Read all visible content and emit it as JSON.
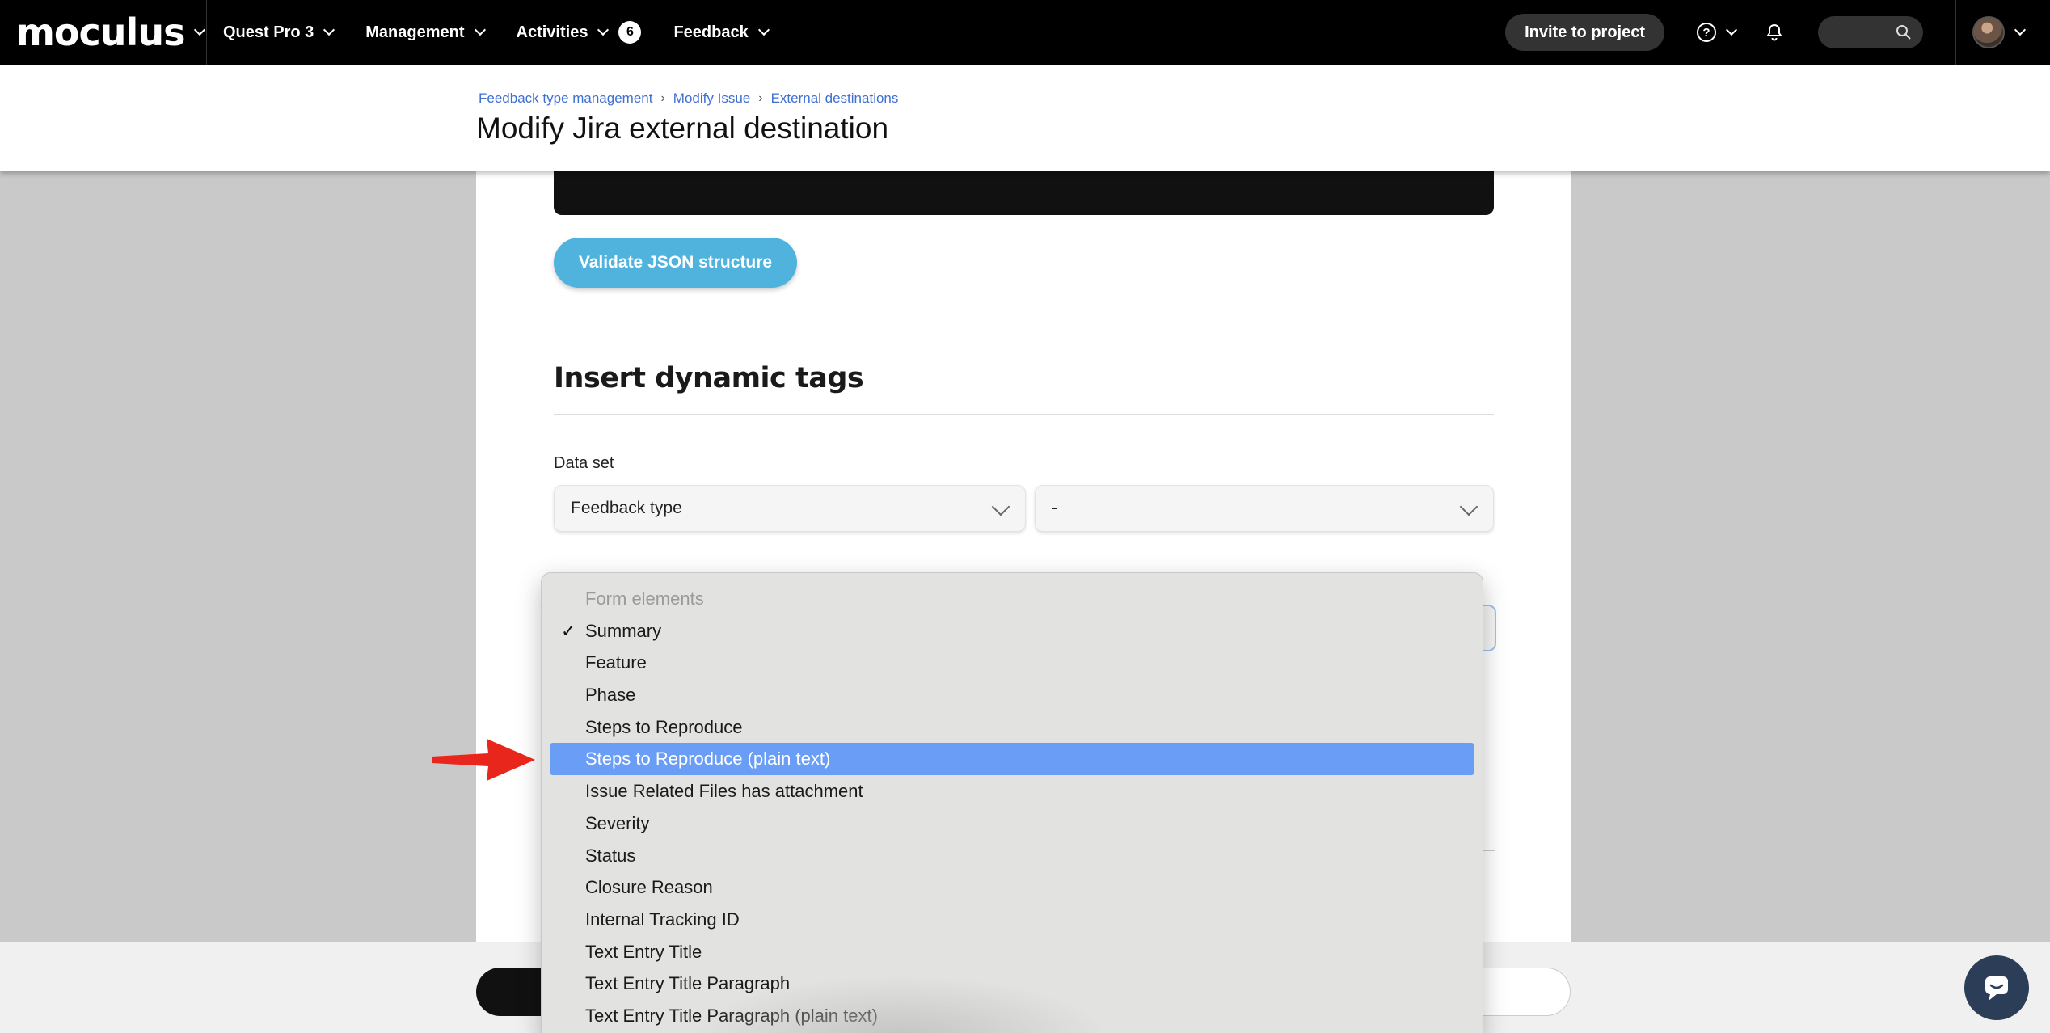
{
  "nav": {
    "logo": "moculus",
    "items": [
      {
        "label": "Quest Pro 3"
      },
      {
        "label": "Management"
      },
      {
        "label": "Activities",
        "badge": "6"
      },
      {
        "label": "Feedback"
      }
    ],
    "invite_label": "Invite to project",
    "help_glyph": "?"
  },
  "header": {
    "breadcrumb": [
      "Feedback type management",
      "Modify Issue",
      "External destinations"
    ],
    "title": "Modify Jira external destination"
  },
  "form": {
    "validate_label": "Validate JSON structure",
    "section_title": "Insert dynamic tags",
    "dataset_label": "Data set",
    "dataset_value": "Feedback type",
    "second_value": "-"
  },
  "dropdown": {
    "group_label": "Form elements",
    "items": [
      {
        "label": "Summary",
        "checked": true
      },
      {
        "label": "Feature"
      },
      {
        "label": "Phase"
      },
      {
        "label": "Steps to Reproduce"
      },
      {
        "label": "Steps to Reproduce (plain text)",
        "highlighted": true
      },
      {
        "label": "Issue Related Files has attachment"
      },
      {
        "label": "Severity"
      },
      {
        "label": "Status"
      },
      {
        "label": "Closure Reason"
      },
      {
        "label": "Internal Tracking ID"
      },
      {
        "label": "Text Entry Title"
      },
      {
        "label": "Text Entry Title Paragraph"
      },
      {
        "label": "Text Entry Title Paragraph (plain text)"
      }
    ]
  },
  "colors": {
    "highlight": "#6a9df5",
    "validate_button": "#4fb3de",
    "breadcrumb_link": "#3f6fd1",
    "arrow": "#e8261c"
  }
}
